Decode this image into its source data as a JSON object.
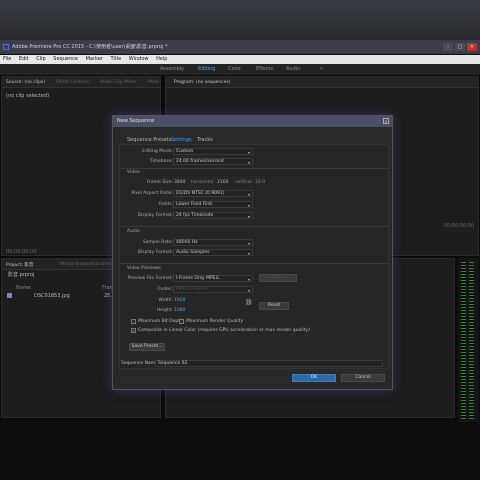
{
  "window": {
    "title": "Adobe Premiere Pro CC 2015 - C:\\使用者\\user\\桌面\\影音.prproj *",
    "buttons": [
      "–",
      "□",
      "✕"
    ]
  },
  "menu": [
    "File",
    "Edit",
    "Clip",
    "Sequence",
    "Marker",
    "Title",
    "Window",
    "Help"
  ],
  "workspaces": {
    "items": [
      "Assembly",
      "Editing",
      "Color",
      "Effects",
      "Audio"
    ],
    "active": "Editing",
    "more": "»"
  },
  "source_panel": {
    "tabs": [
      "Source: (no clips)",
      "Effect Controls",
      "Audio Clip Mixer",
      "Meta"
    ],
    "no_clip": "(no clip selected)",
    "timecode": "00;00;00;00"
  },
  "program_panel": {
    "tab": "Program: (no sequences)",
    "timecode": "00;00;00;00"
  },
  "project_panel": {
    "tabs": [
      "Project: 影音",
      "Media Browser",
      "Libraries"
    ],
    "project_file": "影音.prproj",
    "col_name": "Name",
    "col_fr": "Frame",
    "items": [
      {
        "name": "DSC01853.jpg",
        "frame": "25.00"
      }
    ]
  },
  "dialog": {
    "title": "New Sequence",
    "tabs": [
      "Sequence Presets",
      "Settings",
      "Tracks"
    ],
    "active_tab": "Settings",
    "editing_mode_label": "Editing Mode:",
    "editing_mode": "Custom",
    "timebase_label": "Timebase:",
    "timebase": "24.00 frames/second",
    "video_section": "Video",
    "frame_size_label": "Frame Size:",
    "frame_w": "3840",
    "horizontal": "horizontal",
    "frame_h": "2160",
    "vertical": "vertical",
    "aspect": "16:9",
    "par_label": "Pixel Aspect Ratio:",
    "par": "D1/DV NTSC (0.9091)",
    "fields_label": "Fields:",
    "fields": "Lower Field First",
    "video_display_label": "Display Format:",
    "video_display": "24 fps Timecode",
    "audio_section": "Audio",
    "sample_rate_label": "Sample Rate:",
    "sample_rate": "48000 Hz",
    "audio_display_label": "Display Format:",
    "audio_display": "Audio Samples",
    "preview_section": "Video Previews",
    "preview_format_label": "Preview File Format:",
    "preview_format": "I-Frame Only MPEG",
    "configure": "Configure...",
    "codec_label": "Codec:",
    "codec": "MPEG I-Frame",
    "width_label": "Width:",
    "width": "1920",
    "height_label": "Height:",
    "height": "1080",
    "reset": "Reset",
    "max_bit_depth": "Maximum Bit Depth",
    "max_render_quality": "Maximum Render Quality",
    "linear_color": "Composite in Linear Color (requires GPU acceleration or max render quality)",
    "save_preset": "Save Preset...",
    "seq_name_label": "Sequence Name:",
    "seq_name": "Sequence 02",
    "ok": "OK",
    "cancel": "Cancel"
  }
}
